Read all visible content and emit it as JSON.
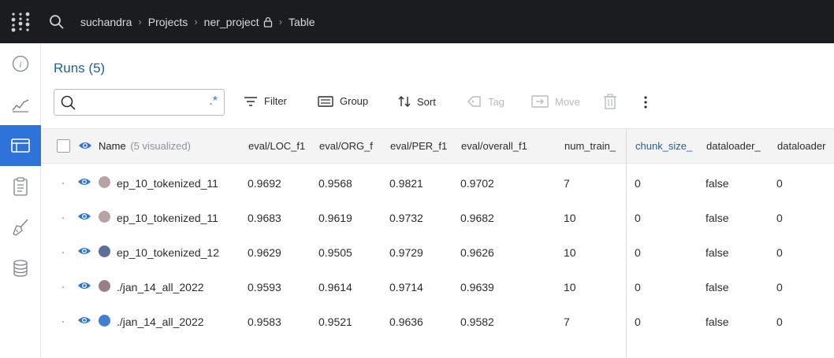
{
  "topbar": {
    "breadcrumbs": [
      "suchandra",
      "Projects",
      "ner_project",
      "Table"
    ],
    "logo_icon": "wandb-dots-icon",
    "search_icon": "search-icon"
  },
  "sidebar": {
    "items": [
      {
        "icon": "info-icon",
        "active": false
      },
      {
        "icon": "chart-line-icon",
        "active": false
      },
      {
        "icon": "table-icon",
        "active": true
      },
      {
        "icon": "clipboard-icon",
        "active": false
      },
      {
        "icon": "broom-icon",
        "active": false
      },
      {
        "icon": "database-icon",
        "active": false
      }
    ]
  },
  "header": {
    "title": "Runs (5)",
    "search": {
      "value": "",
      "regex_label": ".*"
    },
    "toolbar": {
      "filter": "Filter",
      "group": "Group",
      "sort": "Sort",
      "tag": "Tag",
      "move": "Move"
    }
  },
  "table": {
    "name_header": "Name",
    "name_sub": "(5 visualized)",
    "columns": [
      "eval/LOC_f1",
      "eval/ORG_f",
      "eval/PER_f1",
      "eval/overall_f1",
      "num_train_",
      "chunk_size_",
      "dataloader_",
      "dataloader"
    ],
    "rows": [
      {
        "name": "ep_10_tokenized_11",
        "color": "#b7a3a3",
        "values": [
          "0.9692",
          "0.9568",
          "0.9821",
          "0.9702",
          "7",
          "0",
          "false",
          "0"
        ]
      },
      {
        "name": "ep_10_tokenized_11",
        "color": "#b7a3a3",
        "values": [
          "0.9683",
          "0.9619",
          "0.9732",
          "0.9682",
          "10",
          "0",
          "false",
          "0"
        ]
      },
      {
        "name": "ep_10_tokenized_12",
        "color": "#5b6e9c",
        "values": [
          "0.9629",
          "0.9505",
          "0.9729",
          "0.9626",
          "10",
          "0",
          "false",
          "0"
        ]
      },
      {
        "name": "./jan_14_all_2022",
        "color": "#9a7f86",
        "values": [
          "0.9593",
          "0.9614",
          "0.9714",
          "0.9639",
          "10",
          "0",
          "false",
          "0"
        ]
      },
      {
        "name": "./jan_14_all_2022",
        "color": "#3f7fd6",
        "values": [
          "0.9583",
          "0.9521",
          "0.9636",
          "0.9582",
          "7",
          "0",
          "false",
          "0"
        ]
      }
    ]
  },
  "colors": {
    "accent": "#2e73d9",
    "topbar": "#1a1c1f",
    "title": "#1f5faa"
  }
}
